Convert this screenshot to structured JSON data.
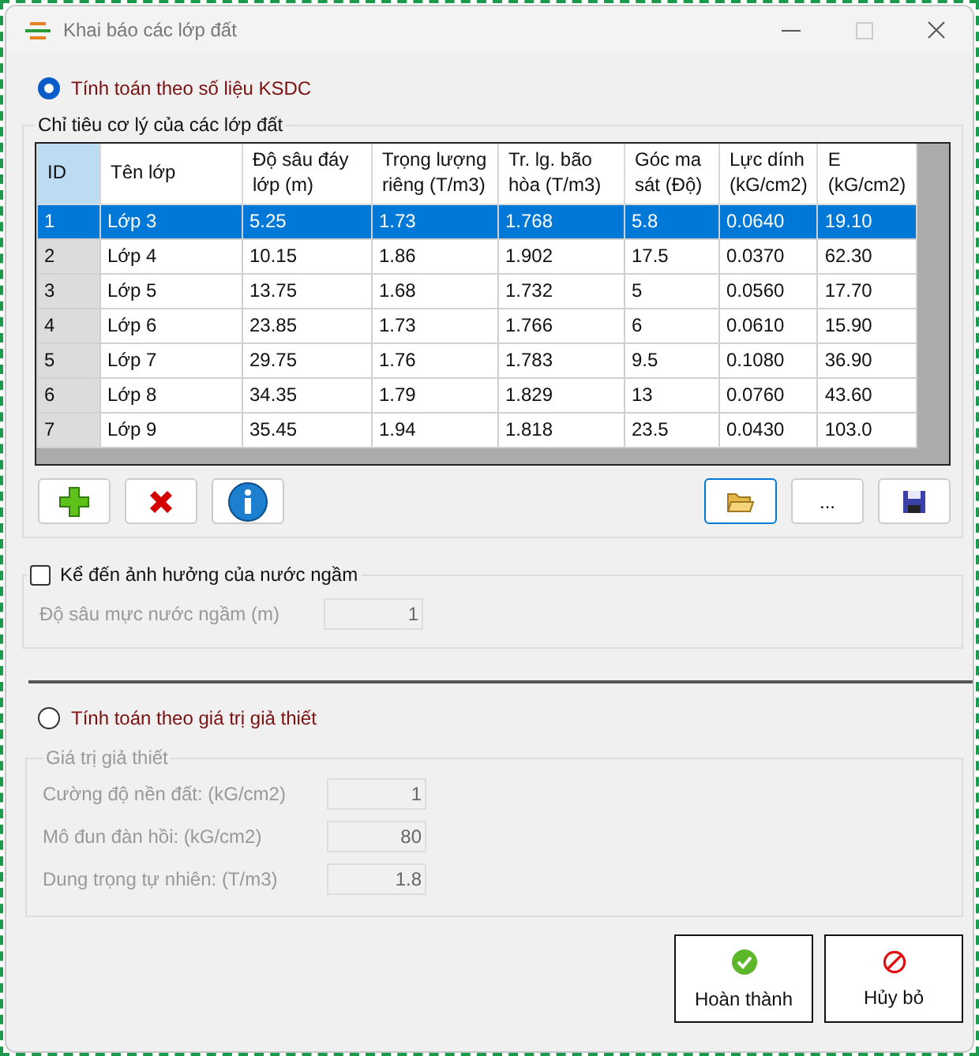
{
  "window": {
    "title": "Khai báo các lớp đất"
  },
  "mode_soil_data": {
    "label": "Tính toán theo số liệu KSDC",
    "selected": true
  },
  "soil_table": {
    "title": "Chỉ tiêu cơ lý của các lớp đất",
    "columns": [
      "ID",
      "Tên lớp",
      "Độ sâu đáy lớp (m)",
      "Trọng lượng riêng (T/m3)",
      "Tr. lg. bão hòa (T/m3)",
      "Góc ma sát (Độ)",
      "Lực dính (kG/cm2)",
      "E (kG/cm2)"
    ],
    "rows": [
      {
        "selected": true,
        "cells": [
          "1",
          "Lớp 3",
          "5.25",
          "1.73",
          "1.768",
          "5.8",
          "0.0640",
          "19.10"
        ]
      },
      {
        "selected": false,
        "cells": [
          "2",
          "Lớp 4",
          "10.15",
          "1.86",
          "1.902",
          "17.5",
          "0.0370",
          "62.30"
        ]
      },
      {
        "selected": false,
        "cells": [
          "3",
          "Lớp 5",
          "13.75",
          "1.68",
          "1.732",
          "5",
          "0.0560",
          "17.70"
        ]
      },
      {
        "selected": false,
        "cells": [
          "4",
          "Lớp 6",
          "23.85",
          "1.73",
          "1.766",
          "6",
          "0.0610",
          "15.90"
        ]
      },
      {
        "selected": false,
        "cells": [
          "5",
          "Lớp 7",
          "29.75",
          "1.76",
          "1.783",
          "9.5",
          "0.1080",
          "36.90"
        ]
      },
      {
        "selected": false,
        "cells": [
          "6",
          "Lớp 8",
          "34.35",
          "1.79",
          "1.829",
          "13",
          "0.0760",
          "43.60"
        ]
      },
      {
        "selected": false,
        "cells": [
          "7",
          "Lớp 9",
          "35.45",
          "1.94",
          "1.818",
          "23.5",
          "0.0430",
          "103.0"
        ]
      }
    ]
  },
  "table_tools": [
    {
      "kind": "add"
    },
    {
      "kind": "delete"
    },
    {
      "kind": "info"
    },
    {
      "kind": "open"
    },
    {
      "kind": "text",
      "label": "..."
    },
    {
      "kind": "save"
    }
  ],
  "groundwater": {
    "label": "Kể đến ảnh hưởng của nước ngầm",
    "checked": false,
    "field": {
      "label": "Độ sâu mực nước ngầm (m)",
      "value": "1"
    }
  },
  "mode_assumed": {
    "label": "Tính toán theo giá trị giả thiết",
    "selected": false
  },
  "assumed_values": {
    "title": "Giá trị giả thiết",
    "disabled": true,
    "fields": [
      {
        "label": "Cường độ nền đất: (kG/cm2)",
        "value": "1"
      },
      {
        "label": "Mô đun đàn hồi: (kG/cm2)",
        "value": "80"
      },
      {
        "label": "Dung trọng tự nhiên: (T/m3)",
        "value": "1.8"
      }
    ]
  },
  "actions": [
    {
      "kind": "ok",
      "label": "Hoàn thành"
    },
    {
      "kind": "cancel",
      "label": "Hủy bỏ"
    }
  ]
}
